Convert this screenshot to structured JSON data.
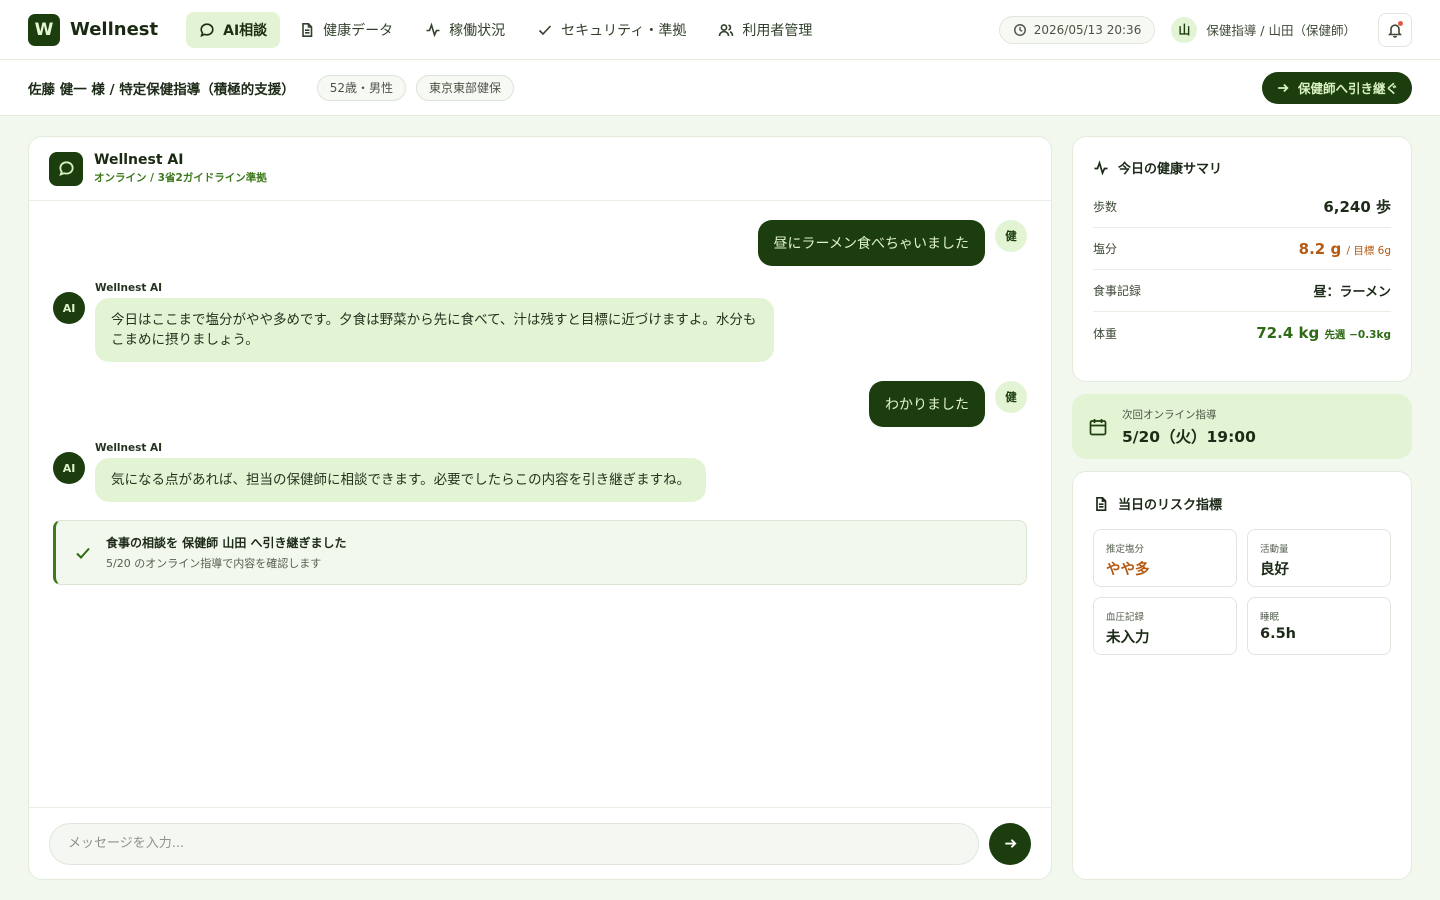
{
  "app": {
    "logo_letter": "W",
    "name": "Wellnest"
  },
  "nav": [
    {
      "label": "AI相談",
      "icon": "chat-icon",
      "active": true
    },
    {
      "label": "健康データ",
      "icon": "document-icon",
      "active": false
    },
    {
      "label": "稼働状況",
      "icon": "activity-icon",
      "active": false
    },
    {
      "label": "セキュリティ・準拠",
      "icon": "check-icon",
      "active": false
    },
    {
      "label": "利用者管理",
      "icon": "users-icon",
      "active": false
    }
  ],
  "header": {
    "datetime": "2026/05/13 20:36",
    "user_initial": "山",
    "user_label": "保健指導 / 山田（保健師）"
  },
  "patient": {
    "title": "佐藤 健一 様 / 特定保健指導（積極的支援）",
    "tags": [
      "52歳・男性",
      "東京東部健保"
    ],
    "handover_label": "保健師へ引き継ぐ"
  },
  "chat": {
    "bot_name": "Wellnest AI",
    "bot_status": "オンライン / 3省2ガイドライン準拠",
    "user_initial": "健",
    "ai_initial": "AI",
    "messages": [
      {
        "from": "user",
        "text": "昼にラーメン食べちゃいました"
      },
      {
        "from": "ai",
        "name": "Wellnest AI",
        "text": "今日はここまで塩分がやや多めです。夕食は野菜から先に食べて、汁は残すと目標に近づけますよ。水分もこまめに摂りましょう。"
      },
      {
        "from": "user",
        "text": "わかりました"
      },
      {
        "from": "ai",
        "name": "Wellnest AI",
        "text": "気になる点があれば、担当の保健師に相談できます。必要でしたらこの内容を引き継ぎますね。"
      }
    ],
    "notice": {
      "title": "食事の相談を 保健師 山田 へ引き継ぎました",
      "sub": "5/20 のオンライン指導で内容を確認します"
    },
    "input_placeholder": "メッセージを入力..."
  },
  "summary": {
    "title": "今日の健康サマリ",
    "rows": [
      {
        "label": "歩数",
        "value": "6,240 歩",
        "note": ""
      },
      {
        "label": "塩分",
        "value": "8.2 g",
        "note": "/ 目標 6g"
      },
      {
        "label": "食事記録",
        "value": "昼：ラーメン",
        "note": ""
      },
      {
        "label": "体重",
        "value": "72.4 kg",
        "note": "先週 −0.3kg"
      }
    ]
  },
  "next_session": {
    "label": "次回オンライン指導",
    "value": "5/20（火）19:00"
  },
  "risk": {
    "title": "当日のリスク指標",
    "items": [
      {
        "label": "推定塩分",
        "value": "やや多",
        "color": "#b55a12"
      },
      {
        "label": "活動量",
        "value": "良好",
        "color": "#1c2a17"
      },
      {
        "label": "血圧記録",
        "value": "未入力",
        "color": "#1c2a17"
      },
      {
        "label": "睡眠",
        "value": "6.5h",
        "color": "#1c2a17"
      }
    ]
  },
  "colors": {
    "brand": "#1c3d0e",
    "accent_light": "#e3f4d4",
    "warning": "#b55a12",
    "success": "#2f6a16"
  }
}
